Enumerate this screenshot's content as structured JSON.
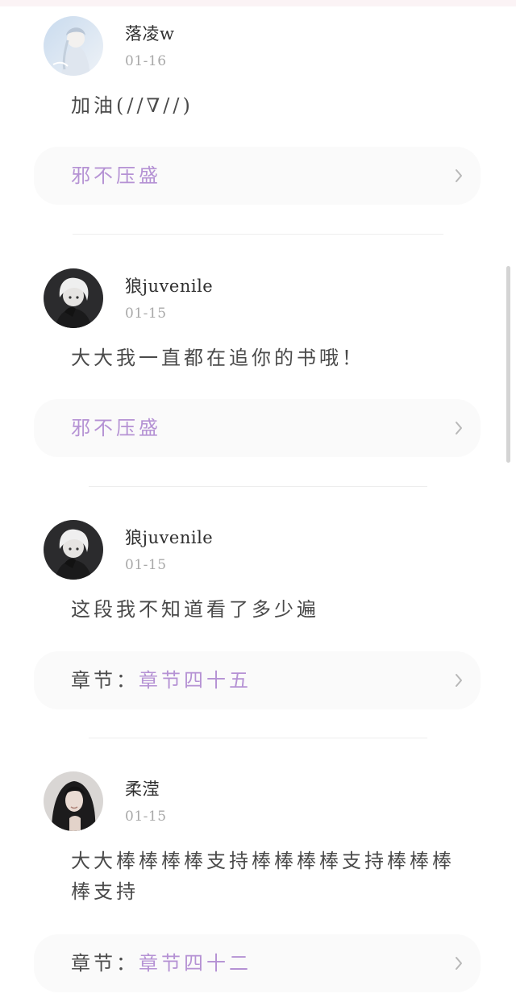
{
  "colors": {
    "accent_purple": "#b592d4",
    "text_dark": "#2f2f2f",
    "text_muted": "#a8a8a8",
    "card_bg": "#fafafa"
  },
  "comments": [
    {
      "user": "落凌w",
      "date": "01-16",
      "text": "加油(//∇//)",
      "reference": {
        "prefix": "",
        "title": "邪不压盛"
      },
      "avatar_icon": "anime-girl-avatar-icon"
    },
    {
      "user": "狼juvenile",
      "date": "01-15",
      "text": "大大我一直都在追你的书哦！",
      "reference": {
        "prefix": "",
        "title": "邪不压盛"
      },
      "avatar_icon": "anime-boy-avatar-icon"
    },
    {
      "user": "狼juvenile",
      "date": "01-15",
      "text": "这段我不知道看了多少遍",
      "reference": {
        "prefix": "章节：",
        "title": "章节四十五"
      },
      "avatar_icon": "anime-boy-avatar-icon"
    },
    {
      "user": "柔滢",
      "date": "01-15",
      "text": "大大棒棒棒棒支持棒棒棒棒支持棒棒棒棒支持",
      "reference": {
        "prefix": "章节：",
        "title": "章节四十二"
      },
      "avatar_icon": "girl-photo-avatar-icon"
    }
  ]
}
